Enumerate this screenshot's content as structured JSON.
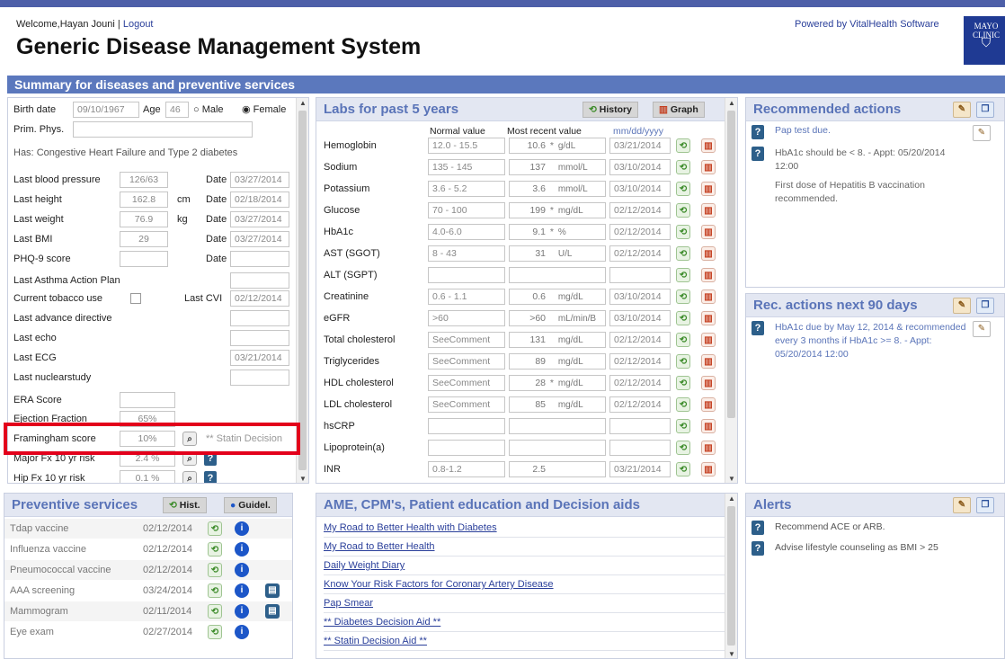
{
  "header": {
    "welcome": "Welcome,Hayan Jouni",
    "logout": "Logout",
    "separator": "|",
    "title": "Generic Disease Management System",
    "powered": "Powered by VitalHealth Software",
    "logo_text": "MAYO CLINIC"
  },
  "summary_bar": "Summary for diseases and preventive services",
  "patient": {
    "birth_label": "Birth date",
    "birth_value": "09/10/1967",
    "age_label": "Age",
    "age_value": "46",
    "male_label": "Male",
    "female_label": "Female",
    "prim_phys_label": "Prim. Phys.",
    "has_label": "Has:",
    "has_value": "Congestive Heart Failure and Type 2 diabetes",
    "date_label": "Date",
    "last_cvi_label": "Last CVI",
    "last_cvi_value": "02/12/2014",
    "rows": [
      {
        "label": "Last blood pressure",
        "value": "126/63",
        "unit": "",
        "date": "03/27/2014"
      },
      {
        "label": "Last height",
        "value": "162.8",
        "unit": "cm",
        "date": "02/18/2014"
      },
      {
        "label": "Last weight",
        "value": "76.9",
        "unit": "kg",
        "date": "03/27/2014"
      },
      {
        "label": "Last BMI",
        "value": "29",
        "unit": "",
        "date": "03/27/2014"
      },
      {
        "label": "PHQ-9 score",
        "value": "",
        "unit": "",
        "date": ""
      }
    ],
    "asthma_label": "Last Asthma Action Plan",
    "tobacco_label": "Current tobacco use",
    "advance_label": "Last advance directive",
    "echo_label": "Last echo",
    "ecg_label": "Last ECG",
    "ecg_value": "03/21/2014",
    "nuclear_label": "Last nuclearstudy",
    "era_label": "ERA Score",
    "ef_label": "Ejection Fraction",
    "ef_value": "65%",
    "fram_label": "Framingham score",
    "fram_value": "10%",
    "fram_link": "** Statin Decision",
    "major_label": "Major Fx 10 yr risk",
    "major_value": "2.4 %",
    "hip_label": "Hip Fx 10 yr risk",
    "hip_value": "0.1 %"
  },
  "labs": {
    "title": "Labs for past 5 years",
    "history_btn": "History",
    "graph_btn": "Graph",
    "col_normal": "Normal value",
    "col_recent": "Most recent value",
    "col_date": "mm/dd/yyyy",
    "rows": [
      {
        "name": "Hemoglobin",
        "normal": "12.0 - 15.5",
        "value": "10.6",
        "flag": "*",
        "unit": "g/dL",
        "date": "03/21/2014"
      },
      {
        "name": "Sodium",
        "normal": "135 - 145",
        "value": "137",
        "flag": "",
        "unit": "mmol/L",
        "date": "03/10/2014"
      },
      {
        "name": "Potassium",
        "normal": "3.6 - 5.2",
        "value": "3.6",
        "flag": "",
        "unit": "mmol/L",
        "date": "03/10/2014"
      },
      {
        "name": "Glucose",
        "normal": "70 - 100",
        "value": "199",
        "flag": "*",
        "unit": "mg/dL",
        "date": "02/12/2014"
      },
      {
        "name": "HbA1c",
        "normal": "4.0-6.0",
        "value": "9.1",
        "flag": "*",
        "unit": "%",
        "date": "02/12/2014"
      },
      {
        "name": "AST (SGOT)",
        "normal": "8 - 43",
        "value": "31",
        "flag": "",
        "unit": "U/L",
        "date": "02/12/2014"
      },
      {
        "name": "ALT (SGPT)",
        "normal": "",
        "value": "",
        "flag": "",
        "unit": "",
        "date": ""
      },
      {
        "name": "Creatinine",
        "normal": "0.6 - 1.1",
        "value": "0.6",
        "flag": "",
        "unit": "mg/dL",
        "date": "03/10/2014"
      },
      {
        "name": "eGFR",
        "normal": ">60",
        "value": ">60",
        "flag": "",
        "unit": "mL/min/B",
        "date": "03/10/2014"
      },
      {
        "name": "Total cholesterol",
        "normal": "SeeComment",
        "value": "131",
        "flag": "",
        "unit": "mg/dL",
        "date": "02/12/2014"
      },
      {
        "name": "Triglycerides",
        "normal": "SeeComment",
        "value": "89",
        "flag": "",
        "unit": "mg/dL",
        "date": "02/12/2014"
      },
      {
        "name": "HDL cholesterol",
        "normal": "SeeComment",
        "value": "28",
        "flag": "*",
        "unit": "mg/dL",
        "date": "02/12/2014"
      },
      {
        "name": "LDL cholesterol",
        "normal": "SeeComment",
        "value": "85",
        "flag": "",
        "unit": "mg/dL",
        "date": "02/12/2014"
      },
      {
        "name": "hsCRP",
        "normal": "",
        "value": "",
        "flag": "",
        "unit": "",
        "date": ""
      },
      {
        "name": "Lipoprotein(a)",
        "normal": "",
        "value": "",
        "flag": "",
        "unit": "",
        "date": ""
      },
      {
        "name": "INR",
        "normal": "0.8-1.2",
        "value": "2.5",
        "flag": "",
        "unit": "",
        "date": "03/21/2014"
      }
    ]
  },
  "recommended": {
    "title": "Recommended actions",
    "items": [
      {
        "text": "Pap test due.",
        "link": true
      },
      {
        "text": "HbA1c should be < 8. - Appt: 05/20/2014 12:00",
        "link": false
      },
      {
        "text": "First dose of Hepatitis B vaccination recommended.",
        "link": false
      }
    ]
  },
  "next90": {
    "title": "Rec. actions next 90 days",
    "items": [
      {
        "text": "HbA1c due by May 12, 2014 & recommended every 3 months if HbA1c >= 8. - Appt: 05/20/2014 12:00"
      }
    ]
  },
  "preventive": {
    "title": "Preventive services",
    "hist_btn": "Hist.",
    "guide_btn": "Guidel.",
    "rows": [
      {
        "name": "Tdap vaccine",
        "date": "02/12/2014",
        "extra": false
      },
      {
        "name": "Influenza vaccine",
        "date": "02/12/2014",
        "extra": false
      },
      {
        "name": "Pneumococcal vaccine",
        "date": "02/12/2014",
        "extra": false
      },
      {
        "name": "AAA screening",
        "date": "03/24/2014",
        "extra": true
      },
      {
        "name": "Mammogram",
        "date": "02/11/2014",
        "extra": true
      },
      {
        "name": "Eye exam",
        "date": "02/27/2014",
        "extra": false
      }
    ]
  },
  "education": {
    "title": "AME, CPM's, Patient education and Decision aids",
    "links": [
      "My Road to Better Health with Diabetes",
      "My Road to Better Health",
      "Daily Weight Diary",
      "Know Your Risk Factors for Coronary Artery Disease",
      "Pap Smear",
      "** Diabetes Decision Aid **",
      "** Statin Decision Aid **"
    ]
  },
  "alerts": {
    "title": "Alerts",
    "items": [
      "Recommend ACE or ARB.",
      "Advise lifestyle counseling as BMI > 25"
    ]
  },
  "colors": {
    "accent": "#5b78bd",
    "title_text": "#5a74b8",
    "highlight": "#e3001b"
  }
}
